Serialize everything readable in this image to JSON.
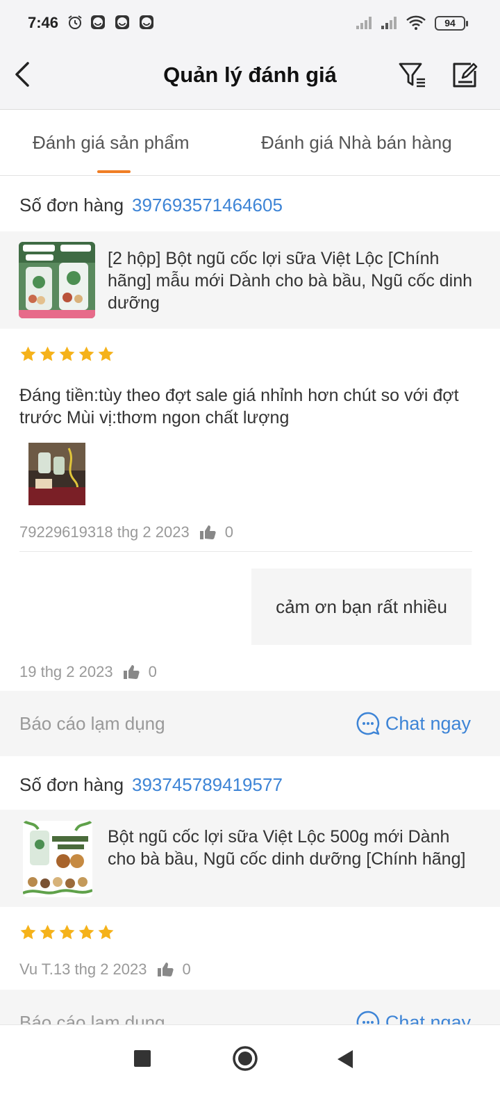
{
  "status_bar": {
    "time": "7:46",
    "battery": "94"
  },
  "header": {
    "title": "Quản lý đánh giá"
  },
  "tabs": [
    {
      "label": "Đánh giá sản phẩm",
      "active": true
    },
    {
      "label": "Đánh giá Nhà bán hàng",
      "active": false
    }
  ],
  "colors": {
    "accent": "#f07e25",
    "link": "#3d84d6",
    "star": "#f5b21a"
  },
  "reviews": [
    {
      "order_label": "Số đơn hàng",
      "order_number": "397693571464605",
      "product_name": "[2 hộp] Bột ngũ cốc lợi sữa Việt Lộc [Chính hãng] mẫu mới Dành cho bà bầu, Ngũ cốc dinh dưỡng",
      "rating": 5,
      "text": "Đáng tiền:tùy theo đợt sale giá nhỉnh hơn chút so với đợt trước Mùi vị:thơm ngon chất lượng",
      "meta_date": "79229619318 thg 2 2023",
      "likes": "0",
      "reply": {
        "text": "cảm ơn bạn rất nhiều",
        "date": "19 thg 2 2023",
        "likes": "0"
      },
      "report_label": "Báo cáo lạm dụng",
      "chat_label": "Chat ngay"
    },
    {
      "order_label": "Số đơn hàng",
      "order_number": "393745789419577",
      "product_name": "Bột ngũ cốc lợi sữa Việt Lộc 500g mới Dành cho bà bầu, Ngũ cốc dinh dưỡng [Chính hãng]",
      "rating": 5,
      "meta_date": "Vu T.13 thg 2 2023",
      "likes": "0",
      "report_label": "Báo cáo lạm dụng",
      "chat_label": "Chat ngay"
    }
  ]
}
